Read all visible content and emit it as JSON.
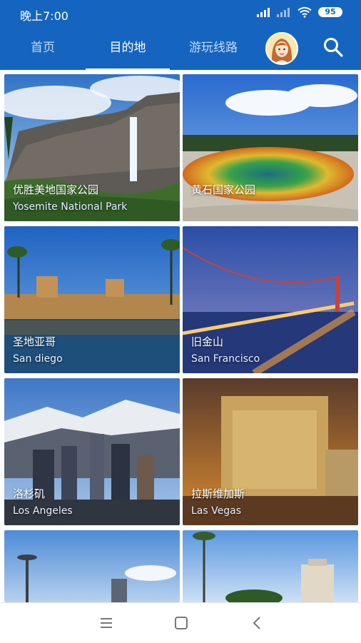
{
  "status_bar": {
    "time": "晚上7:00",
    "battery": "95"
  },
  "tabs": [
    {
      "label": "首页"
    },
    {
      "label": "目的地"
    },
    {
      "label": "游玩线路"
    }
  ],
  "destinations": [
    {
      "name_cn": "优胜美地国家公园",
      "name_en": "Yosemite National Park"
    },
    {
      "name_cn": "黄石国家公园",
      "name_en": ""
    },
    {
      "name_cn": "圣地亚哥",
      "name_en": "San diego"
    },
    {
      "name_cn": "旧金山",
      "name_en": "San Francisco"
    },
    {
      "name_cn": "洛杉矶",
      "name_en": "Los Angeles"
    },
    {
      "name_cn": "拉斯维加斯",
      "name_en": "Las Vegas"
    }
  ],
  "colors": {
    "primary": "#1565c0",
    "tab_inactive": "#c7d8f3"
  },
  "icons": {
    "search": "search-icon",
    "avatar": "avatar",
    "menu": "menu-icon",
    "home": "home-square-icon",
    "back": "back-icon"
  }
}
